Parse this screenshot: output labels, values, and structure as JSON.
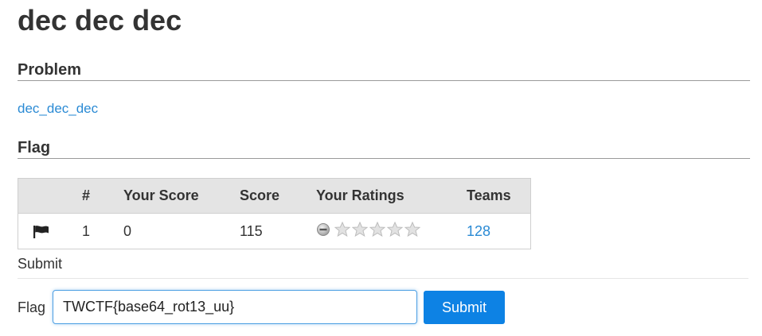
{
  "page": {
    "title": "dec dec dec"
  },
  "problem": {
    "heading": "Problem",
    "link_text": "dec_dec_dec"
  },
  "flag_section": {
    "heading": "Flag"
  },
  "score_table": {
    "columns": [
      "",
      "#",
      "Your Score",
      "Score",
      "Your Ratings",
      "Teams"
    ],
    "rows": [
      {
        "icon": "flag-icon",
        "number": "1",
        "your_score": "0",
        "score": "115",
        "your_rating": 0,
        "rating_max": 5,
        "teams": "128"
      }
    ]
  },
  "submit_form": {
    "heading": "Submit",
    "flag_label": "Flag",
    "flag_value": "TWCTF{base64_rot13_uu}",
    "submit_label": "Submit"
  },
  "colors": {
    "link": "#2a8ad4",
    "button": "#0d82e4",
    "table_header_bg": "#e4e4e4",
    "star_empty": "#d9d9d9"
  }
}
